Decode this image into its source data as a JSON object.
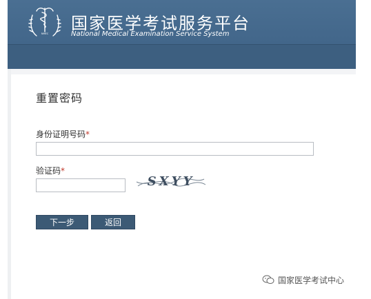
{
  "header": {
    "title": "国家医学考试服务平台",
    "subtitle": "National Medical Examination Service System",
    "emblem_icon": "medical-emblem-icon",
    "background_color": "#42668a"
  },
  "form": {
    "heading": "重置密码",
    "id_number": {
      "label": "身份证明号码",
      "required_mark": "*",
      "value": "",
      "placeholder": ""
    },
    "captcha": {
      "label": "验证码",
      "required_mark": "*",
      "value": "",
      "placeholder": "",
      "image_text": "SXYY"
    },
    "buttons": {
      "next_label": "下一步",
      "back_label": "返回"
    },
    "button_color": "#3c5a75",
    "required_color": "#c0392b"
  },
  "watermark": {
    "text": "国家医学考试中心",
    "icon": "wechat-icon"
  }
}
